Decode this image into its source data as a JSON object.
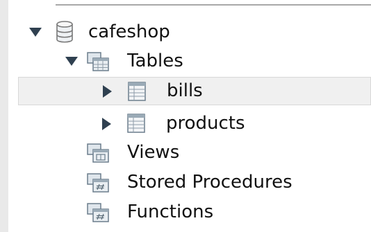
{
  "tree": {
    "schema": {
      "label": "cafeshop",
      "icon": "database-icon",
      "expanded": true
    },
    "tables_folder": {
      "label": "Tables",
      "icon": "tables-folder-icon",
      "expanded": true
    },
    "tables": [
      {
        "label": "bills",
        "icon": "table-icon",
        "expanded": false,
        "selected": true
      },
      {
        "label": "products",
        "icon": "table-icon",
        "expanded": false,
        "selected": false
      }
    ],
    "views_folder": {
      "label": "Views",
      "icon": "views-folder-icon"
    },
    "procedures_folder": {
      "label": "Stored Procedures",
      "icon": "procedures-folder-icon"
    },
    "functions_folder": {
      "label": "Functions",
      "icon": "functions-folder-icon"
    }
  },
  "colors": {
    "selection_bg": "#f0f0f0",
    "expander": "#2f4050",
    "icon_stroke": "#6b7d8c",
    "icon_fill": "#dfe6ec"
  }
}
